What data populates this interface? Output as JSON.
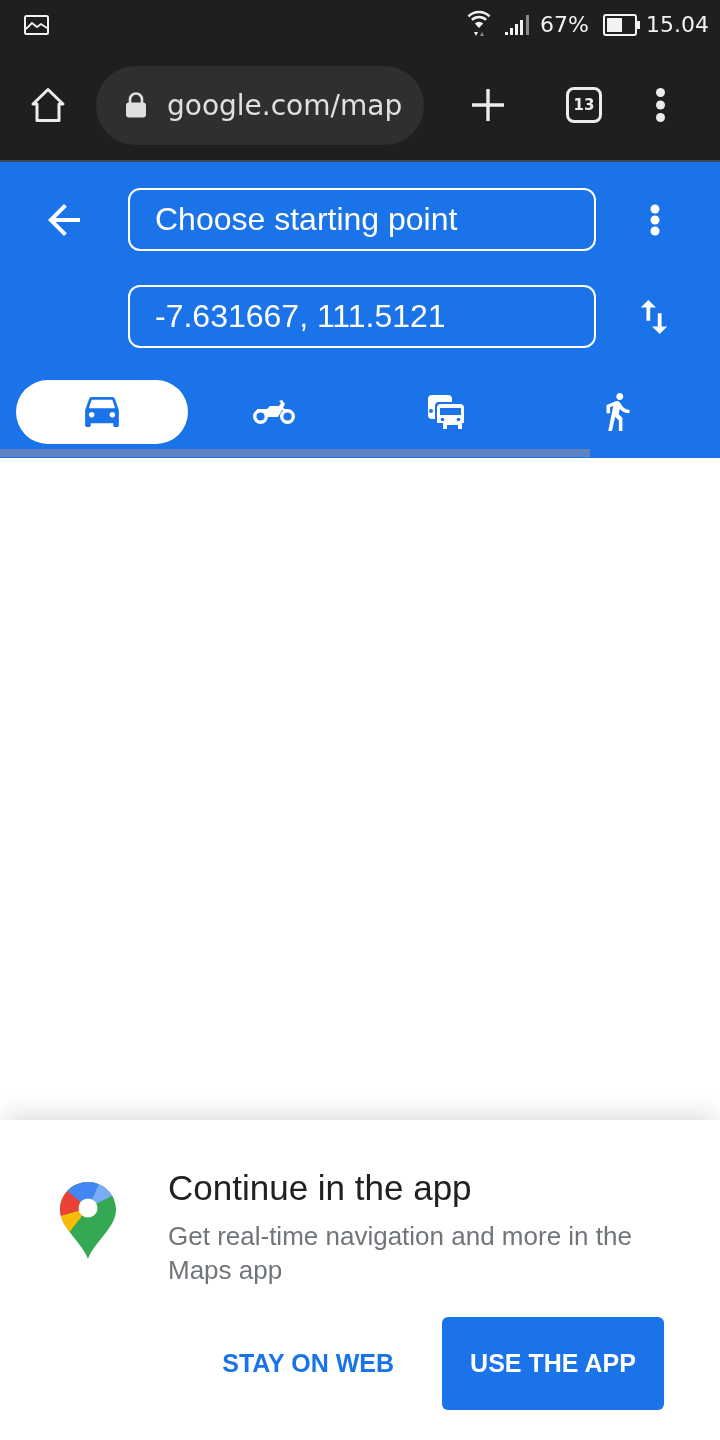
{
  "status_bar": {
    "battery": "67%",
    "time": "15.04"
  },
  "browser": {
    "url": "google.com/map",
    "tab_count": "13"
  },
  "directions": {
    "origin": {
      "placeholder": "Choose starting point"
    },
    "destination": {
      "value": "-7.631667, 111.5121"
    },
    "modes": [
      {
        "kind": "car",
        "selected": true
      },
      {
        "kind": "motorcycle",
        "selected": false
      },
      {
        "kind": "transit",
        "selected": false
      },
      {
        "kind": "walk",
        "selected": false
      }
    ],
    "loading_bar": {
      "level": 0.82
    }
  },
  "app_prompt": {
    "title": "Continue in the app",
    "text": "Get real-time navigation and more in the Maps app",
    "buttons": [
      {
        "label": "STAY ON WEB",
        "kind": "text"
      },
      {
        "label": "USE THE APP",
        "kind": "filled"
      }
    ]
  }
}
